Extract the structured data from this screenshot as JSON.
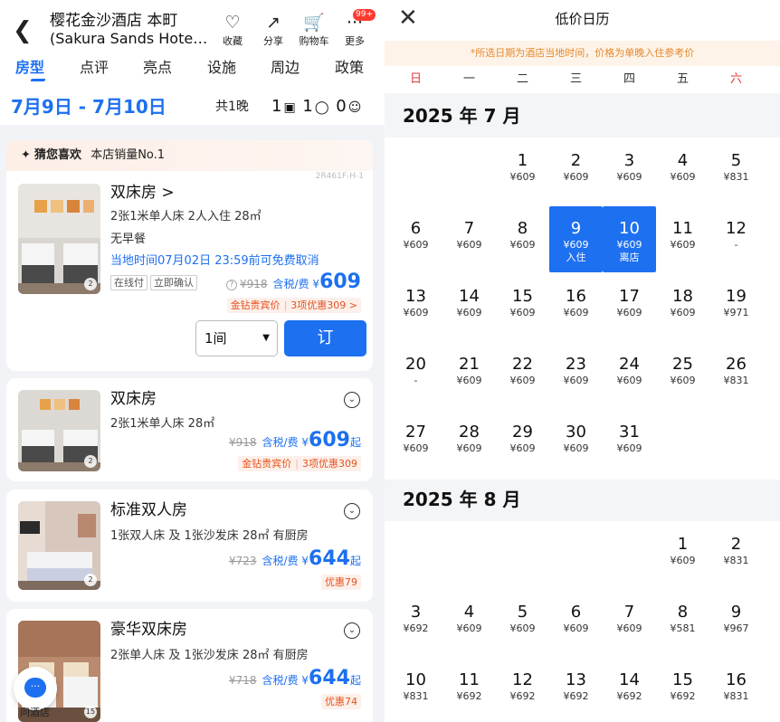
{
  "header": {
    "title": "樱花金沙酒店 本町",
    "subtitle": "(Sakura Sands Hotel...",
    "actions": [
      {
        "label": "收藏",
        "icon": "heart-icon"
      },
      {
        "label": "分享",
        "icon": "share-icon"
      },
      {
        "label": "购物车",
        "icon": "cart-icon"
      },
      {
        "label": "更多",
        "icon": "more-icon"
      }
    ],
    "badge": "99+"
  },
  "tabs": [
    "房型",
    "点评",
    "亮点",
    "设施",
    "周边",
    "政策"
  ],
  "stay": {
    "dates": "7月9日 - 7月10日",
    "nights": "共1晚",
    "rooms": "1",
    "adults": "1",
    "children": "0"
  },
  "rooms": [
    {
      "banner_strong": "猜您喜欢",
      "banner": "本店销量No.1",
      "code": "2R461F-H-1",
      "name": "双床房 >",
      "details": "2张1米单人床  2人入住  28㎡",
      "meal": "无早餐",
      "cancel": "当地时间07月02日 23:59前可免费取消",
      "tags": [
        "在线付",
        "立即确认"
      ],
      "old_price": "¥918",
      "tax": "含税/费",
      "currency": "¥",
      "price": "609",
      "promo_a": "金钻贵宾价",
      "promo_b": "3项优惠309 >",
      "photo_count": "2",
      "qty": "1间",
      "book": "订"
    },
    {
      "name": "双床房",
      "details": "2张1米单人床  28㎡",
      "old_price": "¥918",
      "tax": "含税/费",
      "currency": "¥",
      "price": "609",
      "suffix": "起",
      "promo_a": "金钻贵宾价",
      "promo_b": "3项优惠309",
      "photo_count": "2"
    },
    {
      "name": "标准双人房",
      "details": "1张双人床 及 1张沙发床  28㎡  有厨房",
      "old_price": "¥723",
      "tax": "含税/费",
      "currency": "¥",
      "price": "644",
      "suffix": "起",
      "promo": "优惠79",
      "photo_count": "2"
    },
    {
      "name": "豪华双床房",
      "details": "2张单人床 及 1张沙发床  28㎡  有厨房",
      "old_price": "¥718",
      "tax": "含税/费",
      "currency": "¥",
      "price": "644",
      "suffix": "起",
      "promo": "优惠74",
      "photo_count": "15"
    }
  ],
  "chat_label": "问酒店",
  "calendar": {
    "title": "低价日历",
    "notice": "*所选日期为酒店当地时间，价格为单晚入住参考价",
    "weekdays": [
      "日",
      "一",
      "二",
      "三",
      "四",
      "五",
      "六"
    ],
    "months": [
      {
        "label": "2025 年 7 月",
        "offset": 2,
        "days": [
          {
            "d": "1",
            "p": "¥609"
          },
          {
            "d": "2",
            "p": "¥609"
          },
          {
            "d": "3",
            "p": "¥609"
          },
          {
            "d": "4",
            "p": "¥609"
          },
          {
            "d": "5",
            "p": "¥831"
          },
          {
            "d": "6",
            "p": "¥609"
          },
          {
            "d": "7",
            "p": "¥609"
          },
          {
            "d": "8",
            "p": "¥609"
          },
          {
            "d": "9",
            "p": "¥609",
            "tag": "入住",
            "sel": true
          },
          {
            "d": "10",
            "p": "¥609",
            "tag": "离店",
            "sel": true
          },
          {
            "d": "11",
            "p": "¥609"
          },
          {
            "d": "12",
            "p": "-"
          },
          {
            "d": "13",
            "p": "¥609"
          },
          {
            "d": "14",
            "p": "¥609"
          },
          {
            "d": "15",
            "p": "¥609"
          },
          {
            "d": "16",
            "p": "¥609"
          },
          {
            "d": "17",
            "p": "¥609"
          },
          {
            "d": "18",
            "p": "¥609"
          },
          {
            "d": "19",
            "p": "¥971"
          },
          {
            "d": "20",
            "p": "-"
          },
          {
            "d": "21",
            "p": "¥609"
          },
          {
            "d": "22",
            "p": "¥609"
          },
          {
            "d": "23",
            "p": "¥609"
          },
          {
            "d": "24",
            "p": "¥609"
          },
          {
            "d": "25",
            "p": "¥609"
          },
          {
            "d": "26",
            "p": "¥831"
          },
          {
            "d": "27",
            "p": "¥609"
          },
          {
            "d": "28",
            "p": "¥609"
          },
          {
            "d": "29",
            "p": "¥609"
          },
          {
            "d": "30",
            "p": "¥609"
          },
          {
            "d": "31",
            "p": "¥609"
          }
        ]
      },
      {
        "label": "2025 年 8 月",
        "offset": 5,
        "days": [
          {
            "d": "1",
            "p": "¥609"
          },
          {
            "d": "2",
            "p": "¥831"
          },
          {
            "d": "3",
            "p": "¥692"
          },
          {
            "d": "4",
            "p": "¥609"
          },
          {
            "d": "5",
            "p": "¥609"
          },
          {
            "d": "6",
            "p": "¥609"
          },
          {
            "d": "7",
            "p": "¥609"
          },
          {
            "d": "8",
            "p": "¥581"
          },
          {
            "d": "9",
            "p": "¥967"
          },
          {
            "d": "10",
            "p": "¥831"
          },
          {
            "d": "11",
            "p": "¥692"
          },
          {
            "d": "12",
            "p": "¥692"
          },
          {
            "d": "13",
            "p": "¥692"
          },
          {
            "d": "14",
            "p": "¥692"
          },
          {
            "d": "15",
            "p": "¥692"
          },
          {
            "d": "16",
            "p": "¥831"
          }
        ]
      }
    ]
  }
}
